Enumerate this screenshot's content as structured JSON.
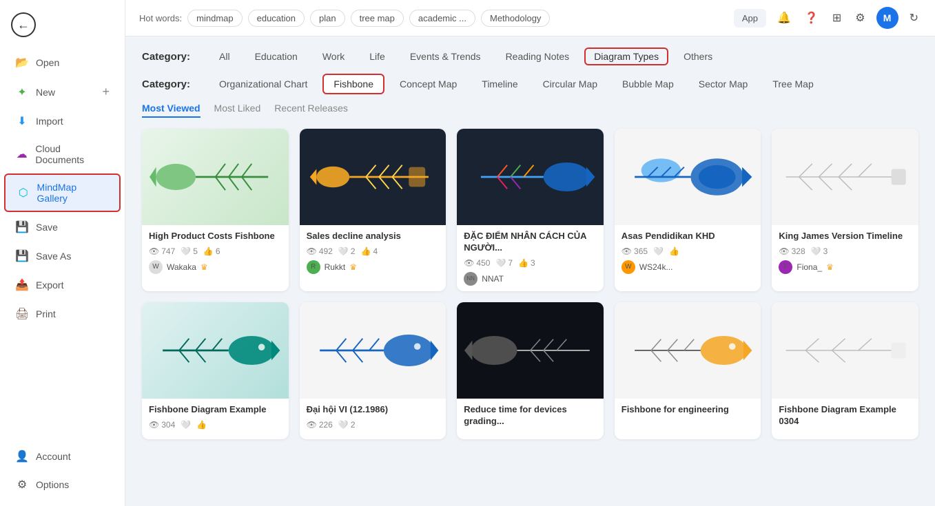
{
  "sidebar": {
    "items": [
      {
        "id": "open",
        "label": "Open",
        "icon": "📂"
      },
      {
        "id": "new",
        "label": "New",
        "icon": "➕",
        "hasPlus": true
      },
      {
        "id": "import",
        "label": "Import",
        "icon": "⬇️"
      },
      {
        "id": "cloud",
        "label": "Cloud Documents",
        "icon": "☁️"
      },
      {
        "id": "mindmap-gallery",
        "label": "MindMap Gallery",
        "icon": "🗺️",
        "active": true
      },
      {
        "id": "save",
        "label": "Save",
        "icon": "💾"
      },
      {
        "id": "save-as",
        "label": "Save As",
        "icon": "💾"
      },
      {
        "id": "export",
        "label": "Export",
        "icon": "📤"
      },
      {
        "id": "print",
        "label": "Print",
        "icon": "🖨️"
      }
    ],
    "bottom_items": [
      {
        "id": "account",
        "label": "Account",
        "icon": "👤"
      },
      {
        "id": "options",
        "label": "Options",
        "icon": "⚙️"
      }
    ]
  },
  "topbar": {
    "hot_words_label": "Hot words:",
    "tags": [
      "mindmap",
      "education",
      "plan",
      "tree map",
      "academic ...",
      "Methodology"
    ],
    "app_button": "App",
    "user_initial": "M"
  },
  "categories": {
    "row1_label": "Category:",
    "row1_items": [
      "All",
      "Education",
      "Work",
      "Life",
      "Events & Trends",
      "Reading Notes",
      "Diagram Types",
      "Others"
    ],
    "row1_active": "Diagram Types",
    "row1_outline": "Diagram Types",
    "row2_label": "Category:",
    "row2_items": [
      "Organizational Chart",
      "Fishbone",
      "Concept Map",
      "Timeline",
      "Circular Map",
      "Bubble Map",
      "Sector Map",
      "Tree Map"
    ],
    "row2_active": "Fishbone"
  },
  "sort_tabs": {
    "items": [
      "Most Viewed",
      "Most Liked",
      "Recent Releases"
    ],
    "active": "Most Viewed"
  },
  "cards": [
    {
      "id": "card1",
      "title": "High Product Costs Fishbone",
      "views": "747",
      "likes": "5",
      "shares": "6",
      "author": "Wakaka",
      "author_verified": true,
      "thumb_bg": "thumb-green",
      "thumb_emoji": "🐟"
    },
    {
      "id": "card2",
      "title": "Sales decline analysis",
      "views": "492",
      "likes": "2",
      "shares": "4",
      "author": "Rukkt",
      "author_verified": true,
      "thumb_bg": "thumb-dark",
      "thumb_emoji": "📊"
    },
    {
      "id": "card3",
      "title": "ĐẶC ĐIỂM NHÂN CÁCH CỦA NGƯỜI...",
      "views": "450",
      "likes": "7",
      "shares": "3",
      "author": "NNAT",
      "author_verified": false,
      "thumb_bg": "thumb-dark",
      "thumb_emoji": "🐠"
    },
    {
      "id": "card4",
      "title": "Asas Pendidikan KHD",
      "views": "365",
      "likes": "",
      "shares": "",
      "author": "WS24k...",
      "author_verified": false,
      "thumb_bg": "thumb-white",
      "thumb_emoji": "🐟"
    },
    {
      "id": "card5",
      "title": "King James Version Timeline",
      "views": "328",
      "likes": "3",
      "shares": "",
      "author": "Fiona_",
      "author_verified": true,
      "thumb_bg": "thumb-white",
      "thumb_emoji": "📋"
    },
    {
      "id": "card6",
      "title": "Fishbone Diagram Example",
      "views": "304",
      "likes": "",
      "shares": "",
      "author": "",
      "author_verified": false,
      "thumb_bg": "thumb-teal",
      "thumb_emoji": "🐡"
    },
    {
      "id": "card7",
      "title": "Đại hội VI (12.1986)",
      "views": "226",
      "likes": "2",
      "shares": "",
      "author": "",
      "author_verified": false,
      "thumb_bg": "thumb-white",
      "thumb_emoji": "🐟"
    },
    {
      "id": "card8",
      "title": "Reduce time for devices grading...",
      "views": "",
      "likes": "",
      "shares": "",
      "author": "",
      "author_verified": false,
      "thumb_bg": "thumb-darkbg",
      "thumb_emoji": "🐠"
    },
    {
      "id": "card9",
      "title": "Fishbone for engineering",
      "views": "",
      "likes": "",
      "shares": "",
      "author": "",
      "author_verified": false,
      "thumb_bg": "thumb-white",
      "thumb_emoji": "🐟"
    },
    {
      "id": "card10",
      "title": "Fishbone Diagram Example 0304",
      "views": "",
      "likes": "",
      "shares": "",
      "author": "",
      "author_verified": false,
      "thumb_bg": "thumb-white",
      "thumb_emoji": "🐟"
    }
  ]
}
